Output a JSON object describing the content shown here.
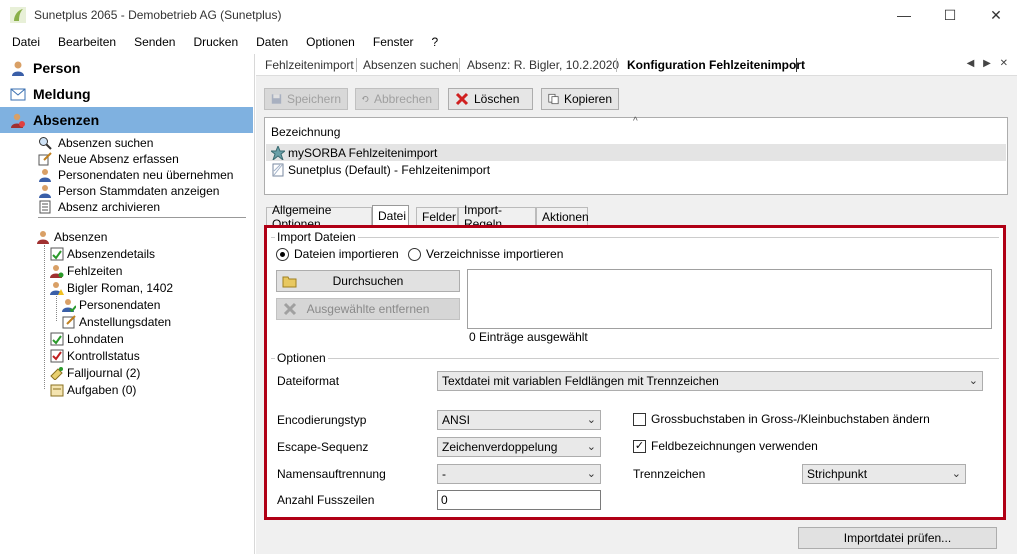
{
  "window": {
    "title": "Sunetplus 2065 - Demobetrieb AG (Sunetplus)",
    "minimize": "—",
    "maximize": "☐",
    "close": "✕"
  },
  "menu": [
    "Datei",
    "Bearbeiten",
    "Senden",
    "Drucken",
    "Daten",
    "Optionen",
    "Fenster",
    "?"
  ],
  "sidebar": {
    "sections": [
      {
        "label": "Person",
        "icon": "person-icon"
      },
      {
        "label": "Meldung",
        "icon": "envelope-icon"
      },
      {
        "label": "Absenzen",
        "icon": "absence-icon",
        "active": true
      }
    ],
    "actions": [
      {
        "label": "Absenzen suchen",
        "icon": "search-icon"
      },
      {
        "label": "Neue Absenz erfassen",
        "icon": "new-absence-icon"
      },
      {
        "label": "Personendaten neu übernehmen",
        "icon": "person-refresh-icon"
      },
      {
        "label": "Person Stammdaten anzeigen",
        "icon": "person-details-icon"
      },
      {
        "label": "Absenz archivieren",
        "icon": "archive-icon"
      }
    ],
    "tree": {
      "root": "Absenzen",
      "items": [
        "Absenzendetails",
        "Fehlzeiten",
        "Bigler Roman, 1402",
        "Lohndaten",
        "Kontrollstatus",
        "Falljournal (2)",
        "Aufgaben (0)"
      ],
      "person_children": [
        "Personendaten",
        "Anstellungsdaten"
      ]
    }
  },
  "doc_tabs": [
    "Fehlzeitenimport",
    "Absenzen suchen",
    "Absenz: R. Bigler, 10.2.2020",
    "Konfiguration Fehlzeitenimport"
  ],
  "doc_tab_arrows": "◀ ▶ ✕",
  "toolbar": {
    "save": "Speichern",
    "cancel": "Abbrechen",
    "delete": "Löschen",
    "copy": "Kopieren"
  },
  "config_list": {
    "header": "Bezeichnung",
    "rows": [
      "mySORBA Fehlzeitenimport",
      "Sunetplus (Default) - Fehlzeitenimport"
    ]
  },
  "inner_tabs": [
    "Allgemeine Optionen",
    "Datei",
    "Felder",
    "Import-Regeln",
    "Aktionen"
  ],
  "import": {
    "group_title": "Import Dateien",
    "radio_files": "Dateien importieren",
    "radio_dirs": "Verzeichnisse importieren",
    "browse": "Durchsuchen",
    "remove": "Ausgewählte entfernen",
    "selected_count": "0 Einträge ausgewählt"
  },
  "options": {
    "group_title": "Optionen",
    "file_format_label": "Dateiformat",
    "file_format_value": "Textdatei mit variablen Feldlängen mit Trennzeichen",
    "encoding_label": "Encodierungstyp",
    "encoding_value": "ANSI",
    "escape_label": "Escape-Sequenz",
    "escape_value": "Zeichenverdoppelung",
    "name_split_label": "Namensauftrennung",
    "name_split_value": "-",
    "footer_label": "Anzahl Fusszeilen",
    "footer_value": "0",
    "uppercase_label": "Grossbuchstaben in Gross-/Kleinbuchstaben ändern",
    "uppercase_checked": false,
    "field_names_label": "Feldbezeichnungen verwenden",
    "field_names_checked": true,
    "separator_label": "Trennzeichen",
    "separator_value": "Strichpunkt"
  },
  "check_button": "Importdatei prüfen...",
  "colors": {
    "accent_border": "#b00015",
    "active_nav": "#7fb1e0"
  }
}
